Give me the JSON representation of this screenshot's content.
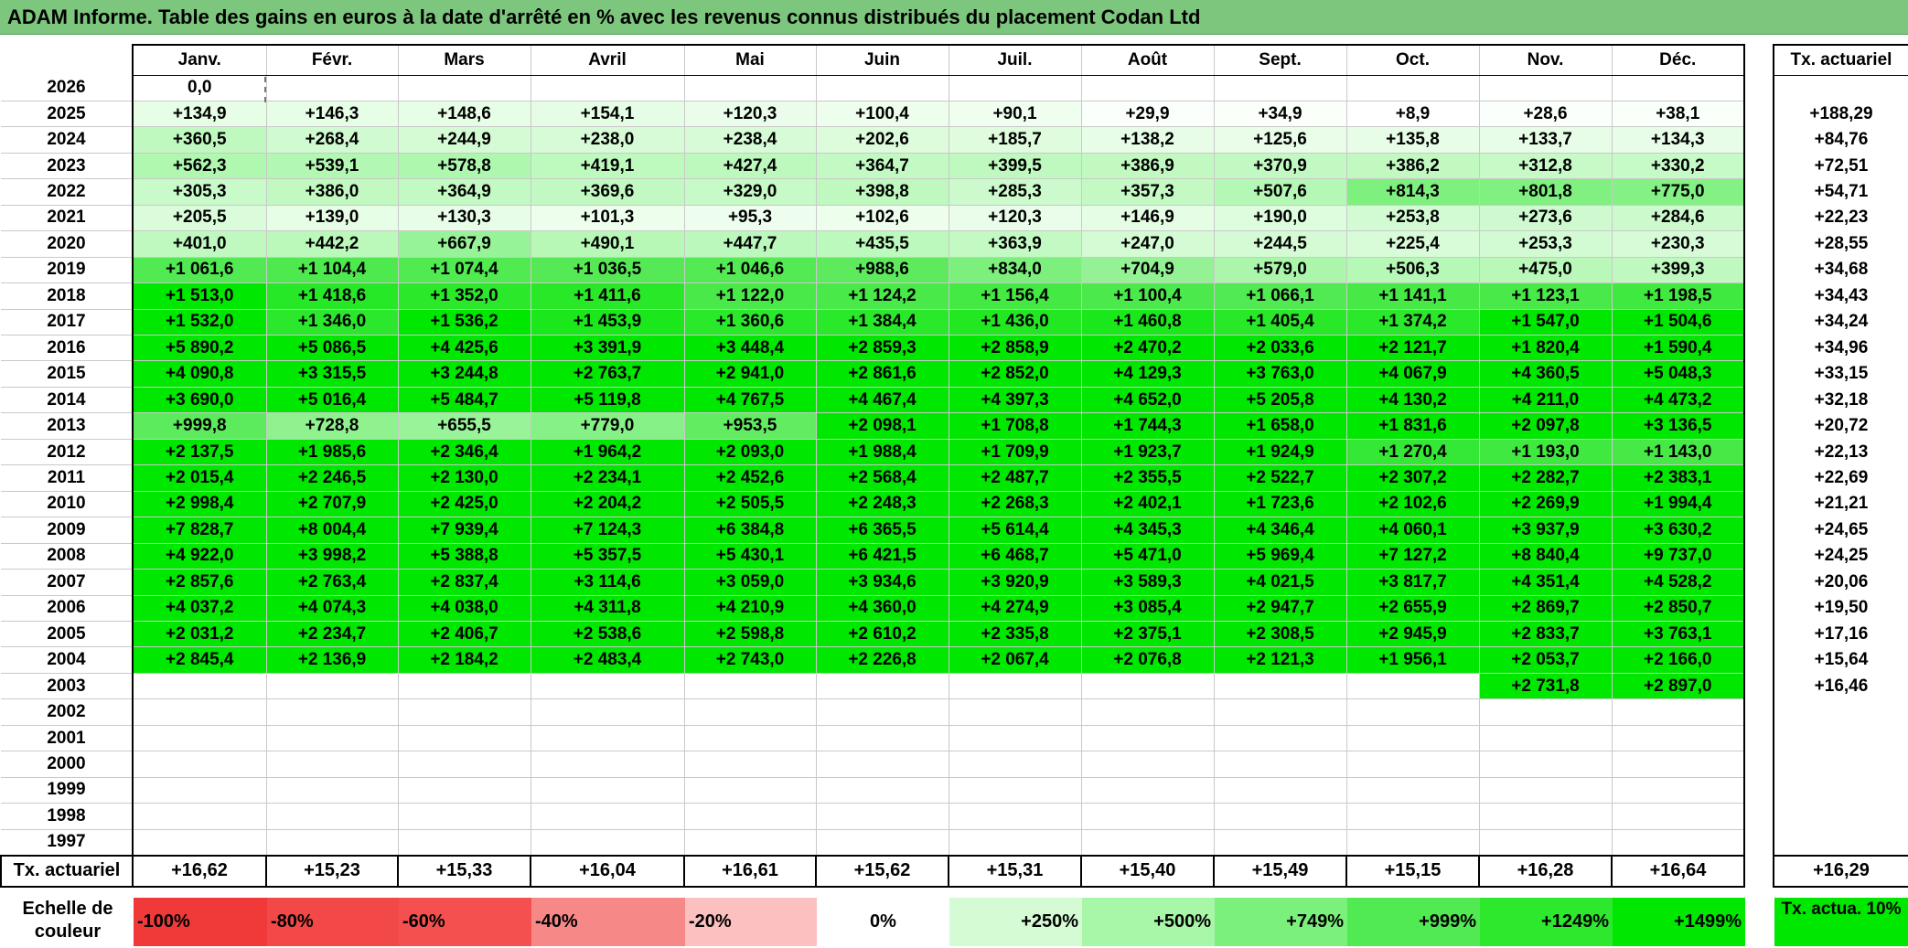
{
  "title": "ADAM Informe. Table des gains en euros à la date d'arrêté en % avec les revenus connus distribués du placement Codan Ltd",
  "months": [
    "Janv.",
    "Févr.",
    "Mars",
    "Avril",
    "Mai",
    "Juin",
    "Juil.",
    "Août",
    "Sept.",
    "Oct.",
    "Nov.",
    "Déc."
  ],
  "rate_header": "Tx. actuariel",
  "rows": [
    {
      "year": "2026",
      "rate": "",
      "values": [
        "0,0",
        "",
        "",
        "",
        "",
        "",
        "",
        "",
        "",
        "",
        "",
        ""
      ],
      "colors": [
        "#ffffff",
        "#ffffff",
        "#ffffff",
        "#ffffff",
        "#ffffff",
        "#ffffff",
        "#ffffff",
        "#ffffff",
        "#ffffff",
        "#ffffff",
        "#ffffff",
        "#ffffff"
      ]
    },
    {
      "year": "2025",
      "rate": "+188,29",
      "values": [
        "+134,9",
        "+146,3",
        "+148,6",
        "+154,1",
        "+120,3",
        "+100,4",
        "+90,1",
        "+29,9",
        "+34,9",
        "+8,9",
        "+28,6",
        "+38,1"
      ],
      "colors": [
        "#e6fde6",
        "#e6fde6",
        "#e6fde6",
        "#e4fde4",
        "#eafdea",
        "#edfeed",
        "#effeef",
        "#fbfffb",
        "#fafffa",
        "#fefffe",
        "#fbfffb",
        "#f9fff9"
      ]
    },
    {
      "year": "2024",
      "rate": "+84,76",
      "values": [
        "+360,5",
        "+268,4",
        "+244,9",
        "+238,0",
        "+238,4",
        "+202,6",
        "+185,7",
        "+138,2",
        "+125,6",
        "+135,8",
        "+133,7",
        "+134,3"
      ],
      "colors": [
        "#c0f9c0",
        "#d0fad0",
        "#d4fbd4",
        "#d6fbd6",
        "#d6fbd6",
        "#dcfcdc",
        "#dffcdf",
        "#e7fde7",
        "#e9fde9",
        "#e7fde7",
        "#e7fde7",
        "#e7fde7"
      ]
    },
    {
      "year": "2023",
      "rate": "+72,51",
      "values": [
        "+562,3",
        "+539,1",
        "+578,8",
        "+419,1",
        "+427,4",
        "+364,7",
        "+399,5",
        "+386,9",
        "+370,9",
        "+386,2",
        "+312,8",
        "+330,2"
      ],
      "colors": [
        "#b0f8b0",
        "#b2f8b2",
        "#aef7ae",
        "#bef9be",
        "#bdf9bd",
        "#c3f9c3",
        "#bff9bf",
        "#c1f9c1",
        "#c2f9c2",
        "#c1f9c1",
        "#c8fac8",
        "#c6fac6"
      ]
    },
    {
      "year": "2022",
      "rate": "+54,71",
      "values": [
        "+305,3",
        "+386,0",
        "+364,9",
        "+369,6",
        "+329,0",
        "+398,8",
        "+285,3",
        "+357,3",
        "+507,6",
        "+814,3",
        "+801,8",
        "+775,0"
      ],
      "colors": [
        "#c9fac9",
        "#c1f9c1",
        "#c3f9c3",
        "#c2f9c2",
        "#c6fac6",
        "#bff9bf",
        "#ccfacc",
        "#c4f9c4",
        "#b5f8b5",
        "#7ef07e",
        "#80f080",
        "#84f184"
      ]
    },
    {
      "year": "2021",
      "rate": "+22,23",
      "values": [
        "+205,5",
        "+139,0",
        "+130,3",
        "+101,3",
        "+95,3",
        "+102,6",
        "+120,3",
        "+146,9",
        "+190,0",
        "+253,8",
        "+273,6",
        "+284,6"
      ],
      "colors": [
        "#dbfcdb",
        "#e6fde6",
        "#e8fde8",
        "#edfeed",
        "#eefeee",
        "#edfeed",
        "#eafdea",
        "#e5fde5",
        "#defcde",
        "#d3fbd3",
        "#cffacf",
        "#cdfacd"
      ]
    },
    {
      "year": "2020",
      "rate": "+28,55",
      "values": [
        "+401,0",
        "+442,2",
        "+667,9",
        "+490,1",
        "+447,7",
        "+435,5",
        "+363,9",
        "+247,0",
        "+244,5",
        "+225,4",
        "+253,3",
        "+230,3"
      ],
      "colors": [
        "#bff9bf",
        "#bbf9bb",
        "#97f397",
        "#b7f8b7",
        "#bbf8bb",
        "#bcf9bc",
        "#c3f9c3",
        "#d4fbd4",
        "#d4fbd4",
        "#d8fbd8",
        "#d3fbd3",
        "#d7fbd7"
      ]
    },
    {
      "year": "2019",
      "rate": "+34,68",
      "values": [
        "+1 061,6",
        "+1 104,4",
        "+1 074,4",
        "+1 036,5",
        "+1 046,6",
        "+988,6",
        "+834,0",
        "+704,9",
        "+579,0",
        "+506,3",
        "+475,0",
        "+399,3"
      ],
      "colors": [
        "#52ea52",
        "#4ee94e",
        "#51ea51",
        "#55ea55",
        "#54ea54",
        "#5deb5d",
        "#7cef7c",
        "#94f294",
        "#acf6ac",
        "#b6f8b6",
        "#b9f8b9",
        "#bff9bf"
      ]
    },
    {
      "year": "2018",
      "rate": "+34,43",
      "values": [
        "+1 513,0",
        "+1 418,6",
        "+1 352,0",
        "+1 411,6",
        "+1 122,0",
        "+1 124,2",
        "+1 156,4",
        "+1 100,4",
        "+1 066,1",
        "+1 141,1",
        "+1 123,1",
        "+1 198,5"
      ],
      "colors": [
        "#00e800",
        "#26e826",
        "#2be82b",
        "#28e828",
        "#48e948",
        "#48e948",
        "#44e944",
        "#4be94b",
        "#52ea52",
        "#46e946",
        "#48e948",
        "#40e940"
      ]
    },
    {
      "year": "2017",
      "rate": "+34,24",
      "values": [
        "+1 532,0",
        "+1 346,0",
        "+1 536,2",
        "+1 453,9",
        "+1 360,6",
        "+1 384,4",
        "+1 436,0",
        "+1 460,8",
        "+1 405,4",
        "+1 374,2",
        "+1 547,0",
        "+1 504,6"
      ],
      "colors": [
        "#00e800",
        "#2ce82c",
        "#00e800",
        "#1ae81a",
        "#2ae82a",
        "#2ae82a",
        "#22e822",
        "#1ae81a",
        "#28e828",
        "#2ae82a",
        "#00e800",
        "#00e800"
      ]
    },
    {
      "year": "2016",
      "rate": "+34,96",
      "values": [
        "+5 890,2",
        "+5 086,5",
        "+4 425,6",
        "+3 391,9",
        "+3 448,4",
        "+2 859,3",
        "+2 858,9",
        "+2 470,2",
        "+2 033,6",
        "+2 121,7",
        "+1 820,4",
        "+1 590,4"
      ],
      "colors": [
        "#00e800",
        "#00e800",
        "#00e800",
        "#00e800",
        "#00e800",
        "#00e800",
        "#00e800",
        "#00e800",
        "#00e800",
        "#00e800",
        "#00e800",
        "#00e800"
      ]
    },
    {
      "year": "2015",
      "rate": "+33,15",
      "values": [
        "+4 090,8",
        "+3 315,5",
        "+3 244,8",
        "+2 763,7",
        "+2 941,0",
        "+2 861,6",
        "+2 852,0",
        "+4 129,3",
        "+3 763,0",
        "+4 067,9",
        "+4 360,5",
        "+5 048,3"
      ],
      "colors": [
        "#00e800",
        "#00e800",
        "#00e800",
        "#00e800",
        "#00e800",
        "#00e800",
        "#00e800",
        "#00e800",
        "#00e800",
        "#00e800",
        "#00e800",
        "#00e800"
      ]
    },
    {
      "year": "2014",
      "rate": "+32,18",
      "values": [
        "+3 690,0",
        "+5 016,4",
        "+5 484,7",
        "+5 119,8",
        "+4 767,5",
        "+4 467,4",
        "+4 397,3",
        "+4 652,0",
        "+5 205,8",
        "+4 130,2",
        "+4 211,0",
        "+4 473,2"
      ],
      "colors": [
        "#00e800",
        "#00e800",
        "#00e800",
        "#00e800",
        "#00e800",
        "#00e800",
        "#00e800",
        "#00e800",
        "#00e800",
        "#00e800",
        "#00e800",
        "#00e800"
      ]
    },
    {
      "year": "2013",
      "rate": "+20,72",
      "values": [
        "+999,8",
        "+728,8",
        "+655,5",
        "+779,0",
        "+953,5",
        "+2 098,1",
        "+1 708,8",
        "+1 744,3",
        "+1 658,0",
        "+1 831,6",
        "+2 097,8",
        "+3 136,5"
      ],
      "colors": [
        "#5ceb5c",
        "#8ff28f",
        "#99f399",
        "#86f186",
        "#62ec62",
        "#00e800",
        "#00e800",
        "#00e800",
        "#00e800",
        "#00e800",
        "#00e800",
        "#00e800"
      ]
    },
    {
      "year": "2012",
      "rate": "+22,13",
      "values": [
        "+2 137,5",
        "+1 985,6",
        "+2 346,4",
        "+1 964,2",
        "+2 093,0",
        "+1 988,4",
        "+1 709,9",
        "+1 923,7",
        "+1 924,9",
        "+1 270,4",
        "+1 193,0",
        "+1 143,0"
      ],
      "colors": [
        "#00e800",
        "#00e800",
        "#00e800",
        "#00e800",
        "#00e800",
        "#00e800",
        "#00e800",
        "#00e800",
        "#00e800",
        "#36e836",
        "#40e940",
        "#46e946"
      ]
    },
    {
      "year": "2011",
      "rate": "+22,69",
      "values": [
        "+2 015,4",
        "+2 246,5",
        "+2 130,0",
        "+2 234,1",
        "+2 452,6",
        "+2 568,4",
        "+2 487,7",
        "+2 355,5",
        "+2 522,7",
        "+2 307,2",
        "+2 282,7",
        "+2 383,1"
      ],
      "colors": [
        "#00e800",
        "#00e800",
        "#00e800",
        "#00e800",
        "#00e800",
        "#00e800",
        "#00e800",
        "#00e800",
        "#00e800",
        "#00e800",
        "#00e800",
        "#00e800"
      ]
    },
    {
      "year": "2010",
      "rate": "+21,21",
      "values": [
        "+2 998,4",
        "+2 707,9",
        "+2 425,0",
        "+2 204,2",
        "+2 505,5",
        "+2 248,3",
        "+2 268,3",
        "+2 402,1",
        "+1 723,6",
        "+2 102,6",
        "+2 269,9",
        "+1 994,4"
      ],
      "colors": [
        "#00e800",
        "#00e800",
        "#00e800",
        "#00e800",
        "#00e800",
        "#00e800",
        "#00e800",
        "#00e800",
        "#00e800",
        "#00e800",
        "#00e800",
        "#00e800"
      ]
    },
    {
      "year": "2009",
      "rate": "+24,65",
      "values": [
        "+7 828,7",
        "+8 004,4",
        "+7 939,4",
        "+7 124,3",
        "+6 384,8",
        "+6 365,5",
        "+5 614,4",
        "+4 345,3",
        "+4 346,4",
        "+4 060,1",
        "+3 937,9",
        "+3 630,2"
      ],
      "colors": [
        "#00e800",
        "#00e800",
        "#00e800",
        "#00e800",
        "#00e800",
        "#00e800",
        "#00e800",
        "#00e800",
        "#00e800",
        "#00e800",
        "#00e800",
        "#00e800"
      ]
    },
    {
      "year": "2008",
      "rate": "+24,25",
      "values": [
        "+4 922,0",
        "+3 998,2",
        "+5 388,8",
        "+5 357,5",
        "+5 430,1",
        "+6 421,5",
        "+6 468,7",
        "+5 471,0",
        "+5 969,4",
        "+7 127,2",
        "+8 840,4",
        "+9 737,0"
      ],
      "colors": [
        "#00e800",
        "#00e800",
        "#00e800",
        "#00e800",
        "#00e800",
        "#00e800",
        "#00e800",
        "#00e800",
        "#00e800",
        "#00e800",
        "#00e800",
        "#00e800"
      ]
    },
    {
      "year": "2007",
      "rate": "+20,06",
      "values": [
        "+2 857,6",
        "+2 763,4",
        "+2 837,4",
        "+3 114,6",
        "+3 059,0",
        "+3 934,6",
        "+3 920,9",
        "+3 589,3",
        "+4 021,5",
        "+3 817,7",
        "+4 351,4",
        "+4 528,2"
      ],
      "colors": [
        "#00e800",
        "#00e800",
        "#00e800",
        "#00e800",
        "#00e800",
        "#00e800",
        "#00e800",
        "#00e800",
        "#00e800",
        "#00e800",
        "#00e800",
        "#00e800"
      ]
    },
    {
      "year": "2006",
      "rate": "+19,50",
      "values": [
        "+4 037,2",
        "+4 074,3",
        "+4 038,0",
        "+4 311,8",
        "+4 210,9",
        "+4 360,0",
        "+4 274,9",
        "+3 085,4",
        "+2 947,7",
        "+2 655,9",
        "+2 869,7",
        "+2 850,7"
      ],
      "colors": [
        "#00e800",
        "#00e800",
        "#00e800",
        "#00e800",
        "#00e800",
        "#00e800",
        "#00e800",
        "#00e800",
        "#00e800",
        "#00e800",
        "#00e800",
        "#00e800"
      ]
    },
    {
      "year": "2005",
      "rate": "+17,16",
      "values": [
        "+2 031,2",
        "+2 234,7",
        "+2 406,7",
        "+2 538,6",
        "+2 598,8",
        "+2 610,2",
        "+2 335,8",
        "+2 375,1",
        "+2 308,5",
        "+2 945,9",
        "+2 833,7",
        "+3 763,1"
      ],
      "colors": [
        "#00e800",
        "#00e800",
        "#00e800",
        "#00e800",
        "#00e800",
        "#00e800",
        "#00e800",
        "#00e800",
        "#00e800",
        "#00e800",
        "#00e800",
        "#00e800"
      ]
    },
    {
      "year": "2004",
      "rate": "+15,64",
      "values": [
        "+2 845,4",
        "+2 136,9",
        "+2 184,2",
        "+2 483,4",
        "+2 743,0",
        "+2 226,8",
        "+2 067,4",
        "+2 076,8",
        "+2 121,3",
        "+1 956,1",
        "+2 053,7",
        "+2 166,0"
      ],
      "colors": [
        "#00e800",
        "#00e800",
        "#00e800",
        "#00e800",
        "#00e800",
        "#00e800",
        "#00e800",
        "#00e800",
        "#00e800",
        "#00e800",
        "#00e800",
        "#00e800"
      ]
    },
    {
      "year": "2003",
      "rate": "+16,46",
      "values": [
        "",
        "",
        "",
        "",
        "",
        "",
        "",
        "",
        "",
        "",
        "+2 731,8",
        "+2 897,0"
      ],
      "colors": [
        "#ffffff",
        "#ffffff",
        "#ffffff",
        "#ffffff",
        "#ffffff",
        "#ffffff",
        "#ffffff",
        "#ffffff",
        "#ffffff",
        "#ffffff",
        "#00e800",
        "#00e800"
      ]
    },
    {
      "year": "2002",
      "rate": "",
      "values": [
        "",
        "",
        "",
        "",
        "",
        "",
        "",
        "",
        "",
        "",
        "",
        ""
      ],
      "colors": [
        "#ffffff",
        "#ffffff",
        "#ffffff",
        "#ffffff",
        "#ffffff",
        "#ffffff",
        "#ffffff",
        "#ffffff",
        "#ffffff",
        "#ffffff",
        "#ffffff",
        "#ffffff"
      ]
    },
    {
      "year": "2001",
      "rate": "",
      "values": [
        "",
        "",
        "",
        "",
        "",
        "",
        "",
        "",
        "",
        "",
        "",
        ""
      ],
      "colors": [
        "#ffffff",
        "#ffffff",
        "#ffffff",
        "#ffffff",
        "#ffffff",
        "#ffffff",
        "#ffffff",
        "#ffffff",
        "#ffffff",
        "#ffffff",
        "#ffffff",
        "#ffffff"
      ]
    },
    {
      "year": "2000",
      "rate": "",
      "values": [
        "",
        "",
        "",
        "",
        "",
        "",
        "",
        "",
        "",
        "",
        "",
        ""
      ],
      "colors": [
        "#ffffff",
        "#ffffff",
        "#ffffff",
        "#ffffff",
        "#ffffff",
        "#ffffff",
        "#ffffff",
        "#ffffff",
        "#ffffff",
        "#ffffff",
        "#ffffff",
        "#ffffff"
      ]
    },
    {
      "year": "1999",
      "rate": "",
      "values": [
        "",
        "",
        "",
        "",
        "",
        "",
        "",
        "",
        "",
        "",
        "",
        ""
      ],
      "colors": [
        "#ffffff",
        "#ffffff",
        "#ffffff",
        "#ffffff",
        "#ffffff",
        "#ffffff",
        "#ffffff",
        "#ffffff",
        "#ffffff",
        "#ffffff",
        "#ffffff",
        "#ffffff"
      ]
    },
    {
      "year": "1998",
      "rate": "",
      "values": [
        "",
        "",
        "",
        "",
        "",
        "",
        "",
        "",
        "",
        "",
        "",
        ""
      ],
      "colors": [
        "#ffffff",
        "#ffffff",
        "#ffffff",
        "#ffffff",
        "#ffffff",
        "#ffffff",
        "#ffffff",
        "#ffffff",
        "#ffffff",
        "#ffffff",
        "#ffffff",
        "#ffffff"
      ]
    },
    {
      "year": "1997",
      "rate": "",
      "values": [
        "",
        "",
        "",
        "",
        "",
        "",
        "",
        "",
        "",
        "",
        "",
        ""
      ],
      "colors": [
        "#ffffff",
        "#ffffff",
        "#ffffff",
        "#ffffff",
        "#ffffff",
        "#ffffff",
        "#ffffff",
        "#ffffff",
        "#ffffff",
        "#ffffff",
        "#ffffff",
        "#ffffff"
      ]
    }
  ],
  "footer": {
    "label": "Tx. actuariel",
    "values": [
      "+16,62",
      "+15,23",
      "+15,33",
      "+16,04",
      "+16,61",
      "+15,62",
      "+15,31",
      "+15,40",
      "+15,49",
      "+15,15",
      "+16,28",
      "+16,64"
    ],
    "total": "+16,29"
  },
  "legend": {
    "label": "Echelle de couleur",
    "cells": [
      {
        "text": "-100%",
        "color": "#f03a3a",
        "kind": "neg"
      },
      {
        "text": "-80%",
        "color": "#f24848",
        "kind": "neg"
      },
      {
        "text": "-60%",
        "color": "#f45050",
        "kind": "neg"
      },
      {
        "text": "-40%",
        "color": "#f78888",
        "kind": "neg"
      },
      {
        "text": "-20%",
        "color": "#fcc0c0",
        "kind": "neg"
      },
      {
        "text": "0%",
        "color": "#ffffff",
        "kind": "zero"
      },
      {
        "text": "+250%",
        "color": "#d4fbd4",
        "kind": "pos"
      },
      {
        "text": "+500%",
        "color": "#a8f6a8",
        "kind": "pos"
      },
      {
        "text": "+749%",
        "color": "#7cf07c",
        "kind": "pos"
      },
      {
        "text": "+999%",
        "color": "#52ea52",
        "kind": "pos"
      },
      {
        "text": "+1249%",
        "color": "#2ee82e",
        "kind": "pos"
      },
      {
        "text": "+1499%",
        "color": "#00e800",
        "kind": "pos"
      }
    ],
    "rate_label": "Tx. actua. 10%",
    "rate_color": "#00e800"
  }
}
